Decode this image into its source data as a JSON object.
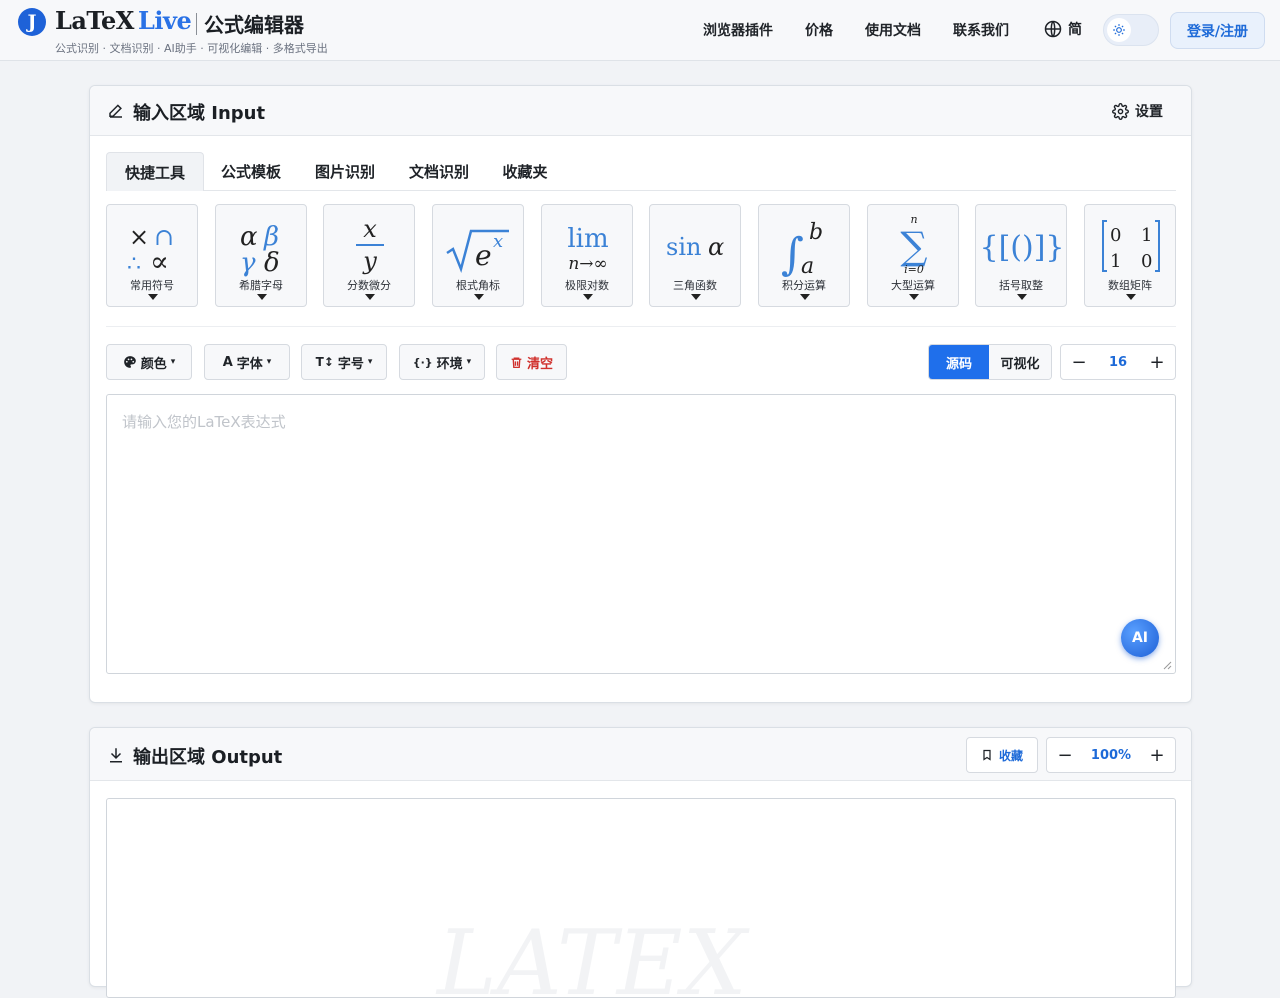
{
  "header": {
    "logo_mark": "J",
    "logo_latex": "LaTeX",
    "logo_live": "Live",
    "logo_cn": "公式编辑器",
    "tagline": "公式识别 · 文档识别 · AI助手 · 可视化编辑 · 多格式导出",
    "nav": [
      "浏览器插件",
      "价格",
      "使用文档",
      "联系我们"
    ],
    "language": "简",
    "login": "登录/注册"
  },
  "input_panel": {
    "title": "输入区域 Input",
    "settings": "设置",
    "tabs": [
      "快捷工具",
      "公式模板",
      "图片识别",
      "文档识别",
      "收藏夹"
    ],
    "active_tab": "快捷工具",
    "tools": [
      {
        "label": "常用符号",
        "icon": "common-symbols-icon"
      },
      {
        "label": "希腊字母",
        "icon": "greek-letters-icon"
      },
      {
        "label": "分数微分",
        "icon": "fraction-icon"
      },
      {
        "label": "根式角标",
        "icon": "radical-icon"
      },
      {
        "label": "极限对数",
        "icon": "limit-icon"
      },
      {
        "label": "三角函数",
        "icon": "trig-icon"
      },
      {
        "label": "积分运算",
        "icon": "integral-icon"
      },
      {
        "label": "大型运算",
        "icon": "sum-icon"
      },
      {
        "label": "括号取整",
        "icon": "brackets-icon"
      },
      {
        "label": "数组矩阵",
        "icon": "matrix-icon"
      }
    ],
    "toolbar": {
      "color": "颜色",
      "font": "字体",
      "size": "字号",
      "env": "环境",
      "clear": "清空",
      "mode_source": "源码",
      "mode_visual": "可视化",
      "font_size_value": "16"
    },
    "editor_placeholder": "请输入您的LaTeX表达式",
    "ai_button": "AI"
  },
  "output_panel": {
    "title": "输出区域 Output",
    "bookmark": "收藏",
    "zoom": "100%"
  },
  "colors": {
    "accent": "#1f6feb",
    "danger": "#d0312d",
    "logo": "#1e62d8"
  }
}
